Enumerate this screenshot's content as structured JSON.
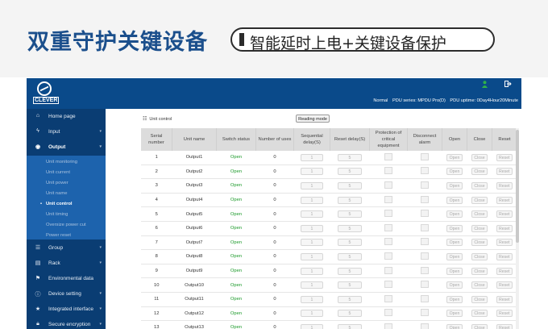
{
  "banner": {
    "title": "双重守护关键设备",
    "subtitle": "智能延时上电+关键设备保护"
  },
  "header": {
    "logo_text": "CLEVER",
    "status_normal": "Normal",
    "pdu_series": "PDU series: MPDU Pro(D)",
    "pdu_uptime": "PDU uptime: 0Day4Hour20Minute",
    "icons": [
      "user-icon",
      "logout-icon"
    ]
  },
  "sidebar": {
    "items": [
      {
        "label": "Home page",
        "icon": "home-icon",
        "chevron": false
      },
      {
        "label": "Input",
        "icon": "bolt-icon",
        "chevron": true
      },
      {
        "label": "Output",
        "icon": "circle-arrow-icon",
        "chevron": true,
        "active": true
      },
      {
        "label": "Group",
        "icon": "layers-icon",
        "chevron": true
      },
      {
        "label": "Rack",
        "icon": "server-icon",
        "chevron": true
      },
      {
        "label": "Environmental data",
        "icon": "flag-icon",
        "chevron": false
      },
      {
        "label": "Device setting",
        "icon": "info-icon",
        "chevron": true
      },
      {
        "label": "Integrated interface",
        "icon": "star-icon",
        "chevron": true
      },
      {
        "label": "Secure encryption",
        "icon": "lock-icon",
        "chevron": true
      }
    ],
    "output_submenu": [
      {
        "label": "Unit monitoring"
      },
      {
        "label": "Unit current"
      },
      {
        "label": "Unit power"
      },
      {
        "label": "Unit name"
      },
      {
        "label": "Unit control",
        "active": true
      },
      {
        "label": "Unit timing"
      },
      {
        "label": "Oversize power cut"
      },
      {
        "label": "Power reset"
      }
    ]
  },
  "main": {
    "section_title": "Unit control",
    "mode_button": "Reading mode",
    "table": {
      "headers": [
        "Serial number",
        "Unit name",
        "Switch status",
        "Number of uses",
        "Sequential delay(S)",
        "Reset delay(S)",
        "Protection of critical equipment",
        "Disconnect alarm",
        "Open",
        "Close",
        "Reset"
      ],
      "rows": [
        {
          "serial": "1",
          "name": "Output1",
          "status": "Open",
          "uses": "0",
          "seq_delay": "1",
          "reset_delay": "5"
        },
        {
          "serial": "2",
          "name": "Output2",
          "status": "Open",
          "uses": "0",
          "seq_delay": "1",
          "reset_delay": "5"
        },
        {
          "serial": "3",
          "name": "Output3",
          "status": "Open",
          "uses": "0",
          "seq_delay": "1",
          "reset_delay": "5"
        },
        {
          "serial": "4",
          "name": "Output4",
          "status": "Open",
          "uses": "0",
          "seq_delay": "1",
          "reset_delay": "5"
        },
        {
          "serial": "5",
          "name": "Output5",
          "status": "Open",
          "uses": "0",
          "seq_delay": "1",
          "reset_delay": "5"
        },
        {
          "serial": "6",
          "name": "Output6",
          "status": "Open",
          "uses": "0",
          "seq_delay": "1",
          "reset_delay": "5"
        },
        {
          "serial": "7",
          "name": "Output7",
          "status": "Open",
          "uses": "0",
          "seq_delay": "1",
          "reset_delay": "5"
        },
        {
          "serial": "8",
          "name": "Output8",
          "status": "Open",
          "uses": "0",
          "seq_delay": "1",
          "reset_delay": "5"
        },
        {
          "serial": "9",
          "name": "Output9",
          "status": "Open",
          "uses": "0",
          "seq_delay": "1",
          "reset_delay": "5"
        },
        {
          "serial": "10",
          "name": "Output10",
          "status": "Open",
          "uses": "0",
          "seq_delay": "1",
          "reset_delay": "5"
        },
        {
          "serial": "11",
          "name": "Output11",
          "status": "Open",
          "uses": "0",
          "seq_delay": "1",
          "reset_delay": "5"
        },
        {
          "serial": "12",
          "name": "Output12",
          "status": "Open",
          "uses": "0",
          "seq_delay": "1",
          "reset_delay": "5"
        },
        {
          "serial": "13",
          "name": "Output13",
          "status": "Open",
          "uses": "0",
          "seq_delay": "1",
          "reset_delay": "5"
        }
      ],
      "button_labels": {
        "open": "Open",
        "close": "Close",
        "reset": "Reset"
      }
    }
  },
  "colors": {
    "brand_blue": "#1b4f8c",
    "topbar": "#0a4a8a",
    "sidebar": "#0a3d73",
    "submenu": "#1d63ad",
    "open_status": "#1c9a2a",
    "user_icon": "#2fb24a"
  }
}
